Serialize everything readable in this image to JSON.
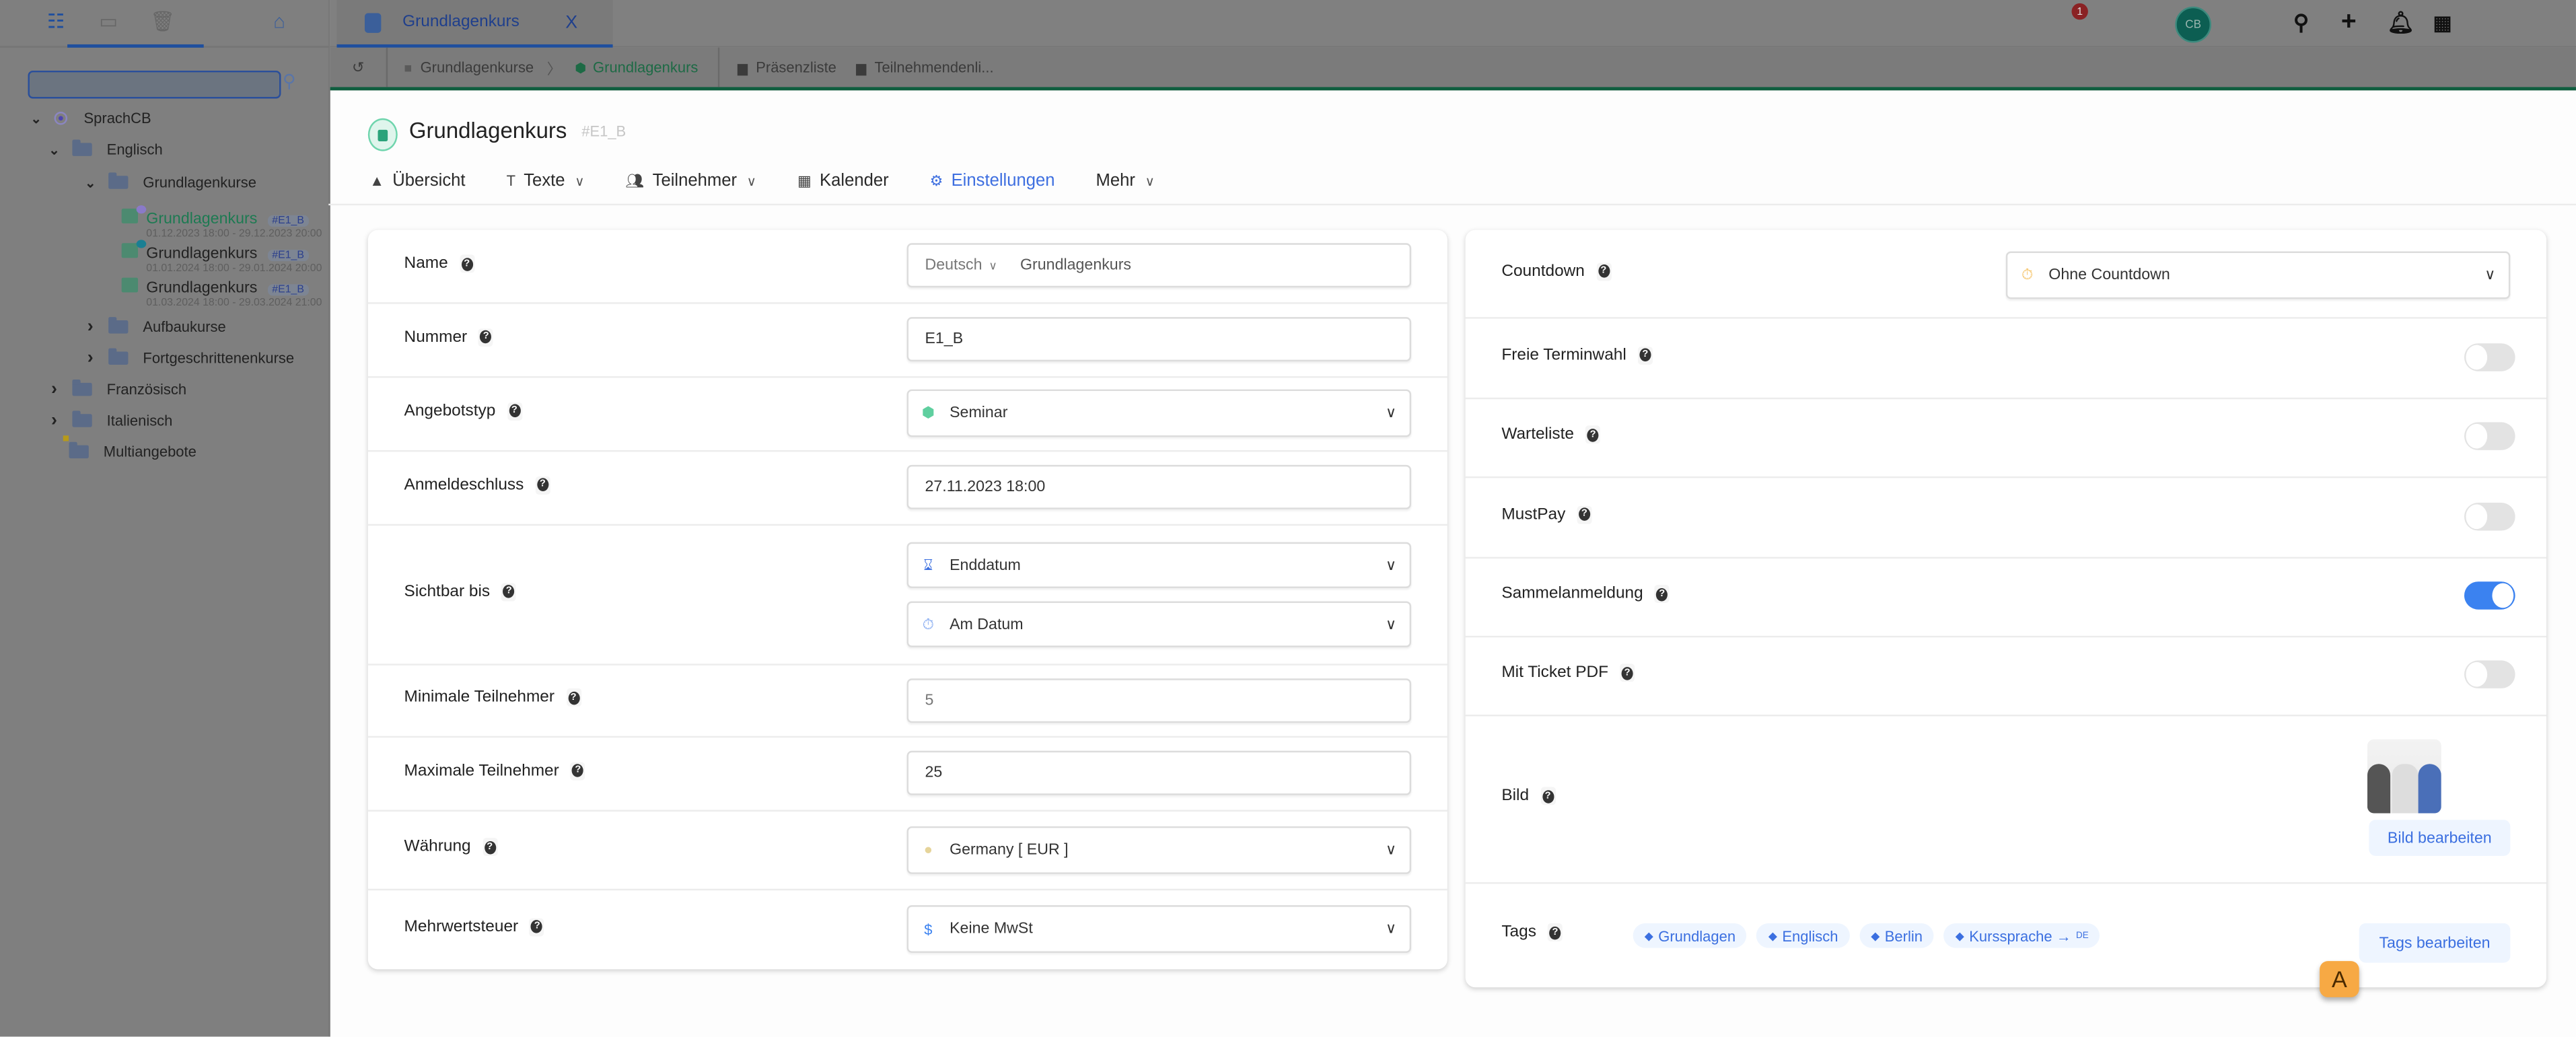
{
  "sidebar": {
    "tabs": [
      {
        "icon": "tree-icon",
        "active": true
      },
      {
        "icon": "archive-icon",
        "active": false
      },
      {
        "icon": "trash-icon",
        "active": false
      }
    ],
    "home_icon": "home-icon",
    "search_placeholder": "",
    "tree": [
      {
        "label": "SprachCB",
        "level": 0,
        "expanded": true,
        "icon": "org-icon"
      },
      {
        "label": "Englisch",
        "level": 1,
        "expanded": true,
        "icon": "folder-icon"
      },
      {
        "label": "Grundlagenkurse",
        "level": 2,
        "expanded": true,
        "icon": "folder-icon"
      }
    ],
    "courses": [
      {
        "title": "Grundlagenkurs",
        "tag": "#E1_B",
        "dates": "01.12.2023 18:00 - 29.12.2023 20:00",
        "active": true,
        "dot_color": "#8a7ac8"
      },
      {
        "title": "Grundlagenkurs",
        "tag": "#E1_B",
        "dates": "01.01.2024 18:00 - 29.01.2024 20:00",
        "active": false,
        "dot_color": "#1a7f93"
      },
      {
        "title": "Grundlagenkurs",
        "tag": "#E1_B",
        "dates": "01.03.2024 18:00 - 29.03.2024 21:00",
        "active": false,
        "dot_color": ""
      }
    ],
    "tree_after": [
      {
        "label": "Aufbaukurse",
        "level": 2,
        "expanded": false
      },
      {
        "label": "Fortgeschrittenenkurse",
        "level": 2,
        "expanded": false
      },
      {
        "label": "Französisch",
        "level": 1,
        "expanded": false
      },
      {
        "label": "Italienisch",
        "level": 1,
        "expanded": false
      },
      {
        "label": "Multiangebote",
        "level": 1,
        "locked": true
      }
    ]
  },
  "topbar": {
    "tab_label": "Grundlagenkurs",
    "tab_close": "X",
    "notification_count": "1",
    "avatar_initials": "CB"
  },
  "breadcrumb": {
    "back_icon": "history-icon",
    "items": [
      "Grundlagenkurse",
      "Grundlagenkurs"
    ],
    "separator": "〉",
    "actions": [
      "Präsenzliste",
      "Teilnehmendenli..."
    ]
  },
  "header": {
    "title": "Grundlagenkurs",
    "tag": "#E1_B",
    "nav": [
      {
        "label": "Übersicht",
        "icon": "chart-icon",
        "dropdown": false,
        "active": false
      },
      {
        "label": "Texte",
        "icon": "text-icon",
        "dropdown": true,
        "active": false
      },
      {
        "label": "Teilnehmer",
        "icon": "users-icon",
        "dropdown": true,
        "active": false
      },
      {
        "label": "Kalender",
        "icon": "calendar-icon",
        "dropdown": false,
        "active": false
      },
      {
        "label": "Einstellungen",
        "icon": "gears-icon",
        "dropdown": false,
        "active": true
      },
      {
        "label": "Mehr",
        "icon": "",
        "dropdown": true,
        "active": false
      }
    ]
  },
  "left_form": [
    {
      "label": "Name",
      "type": "lang-text",
      "lang": "Deutsch",
      "value": "Grundlagenkurs"
    },
    {
      "label": "Nummer",
      "type": "text",
      "value": "E1_B"
    },
    {
      "label": "Angebotstyp",
      "type": "select",
      "value": "Seminar",
      "icon": "seminar-cube-icon"
    },
    {
      "label": "Anmeldeschluss",
      "type": "text",
      "value": "27.11.2023 18:00"
    },
    {
      "label": "Sichtbar bis",
      "type": "select2",
      "values": [
        "Enddatum",
        "Am Datum"
      ],
      "icons": [
        "hourglass-icon",
        "stopwatch-icon"
      ]
    },
    {
      "label": "Minimale Teilnehmer",
      "type": "text",
      "placeholder": "5"
    },
    {
      "label": "Maximale Teilnehmer",
      "type": "text",
      "value": "25"
    },
    {
      "label": "Währung",
      "type": "select",
      "value": "Germany [ EUR ]",
      "icon": "coins-icon"
    },
    {
      "label": "Mehrwertsteuer",
      "type": "select",
      "value": "Keine MwSt",
      "icon": "hand-dollar-icon"
    }
  ],
  "right_form": {
    "countdown": {
      "label": "Countdown",
      "value": "Ohne Countdown"
    },
    "toggles": [
      {
        "label": "Freie Terminwahl",
        "on": false
      },
      {
        "label": "Warteliste",
        "on": false
      },
      {
        "label": "MustPay",
        "on": false
      },
      {
        "label": "Sammelanmeldung",
        "on": true
      },
      {
        "label": "Mit Ticket PDF",
        "on": false
      }
    ],
    "bild": {
      "label": "Bild",
      "button": "Bild bearbeiten"
    },
    "tags": {
      "label": "Tags",
      "items": [
        {
          "label": "Grundlagen"
        },
        {
          "label": "Englisch"
        },
        {
          "label": "Berlin"
        },
        {
          "label": "Kurssprache →",
          "sup": "DE"
        }
      ],
      "button": "Tags bearbeiten"
    }
  },
  "overlay_badge": "A",
  "colors": {
    "accent": "#3b6fe0",
    "toggle_on": "#3b82f0",
    "brand_green": "#1d7a52",
    "badge": "#f7a944"
  }
}
